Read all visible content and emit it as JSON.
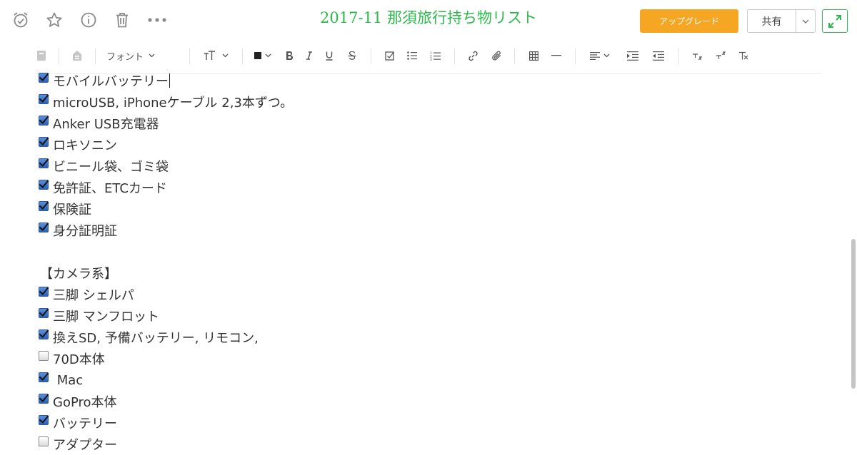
{
  "note": {
    "title": "2017-11 那須旅行持ち物リスト"
  },
  "header": {
    "icons": [
      "alarm-icon",
      "star-icon",
      "info-icon",
      "trash-icon",
      "more-icon"
    ],
    "upgrade_label": "アップグレード",
    "share_label": "共有",
    "accent_color": "#2db84c",
    "upgrade_color": "#f5a623"
  },
  "toolbar": {
    "font_label": "フォント"
  },
  "content": {
    "items": [
      {
        "checked": true,
        "text": "モバイルバッテリー"
      },
      {
        "checked": true,
        "text": "microUSB, iPhoneケーブル 2,3本ずつ。"
      },
      {
        "checked": true,
        "text": "Anker USB充電器"
      },
      {
        "checked": true,
        "text": "ロキソニン"
      },
      {
        "checked": true,
        "text": "ビニール袋、ゴミ袋"
      },
      {
        "checked": true,
        "text": "免許証、ETCカード"
      },
      {
        "checked": true,
        "text": "保険証"
      },
      {
        "checked": true,
        "text": "身分証明証"
      }
    ],
    "camera_heading": "【カメラ系】",
    "camera_items": [
      {
        "checked": true,
        "text": "三脚 シェルパ"
      },
      {
        "checked": true,
        "text": "三脚 マンフロット"
      },
      {
        "checked": true,
        "text": "換えSD, 予備バッテリー, リモコン,"
      },
      {
        "checked": false,
        "text": "70D本体"
      },
      {
        "checked": true,
        "text": " Mac"
      },
      {
        "checked": true,
        "text": "GoPro本体"
      },
      {
        "checked": true,
        "text": "バッテリー"
      },
      {
        "checked": false,
        "text": "アダプター"
      }
    ]
  }
}
